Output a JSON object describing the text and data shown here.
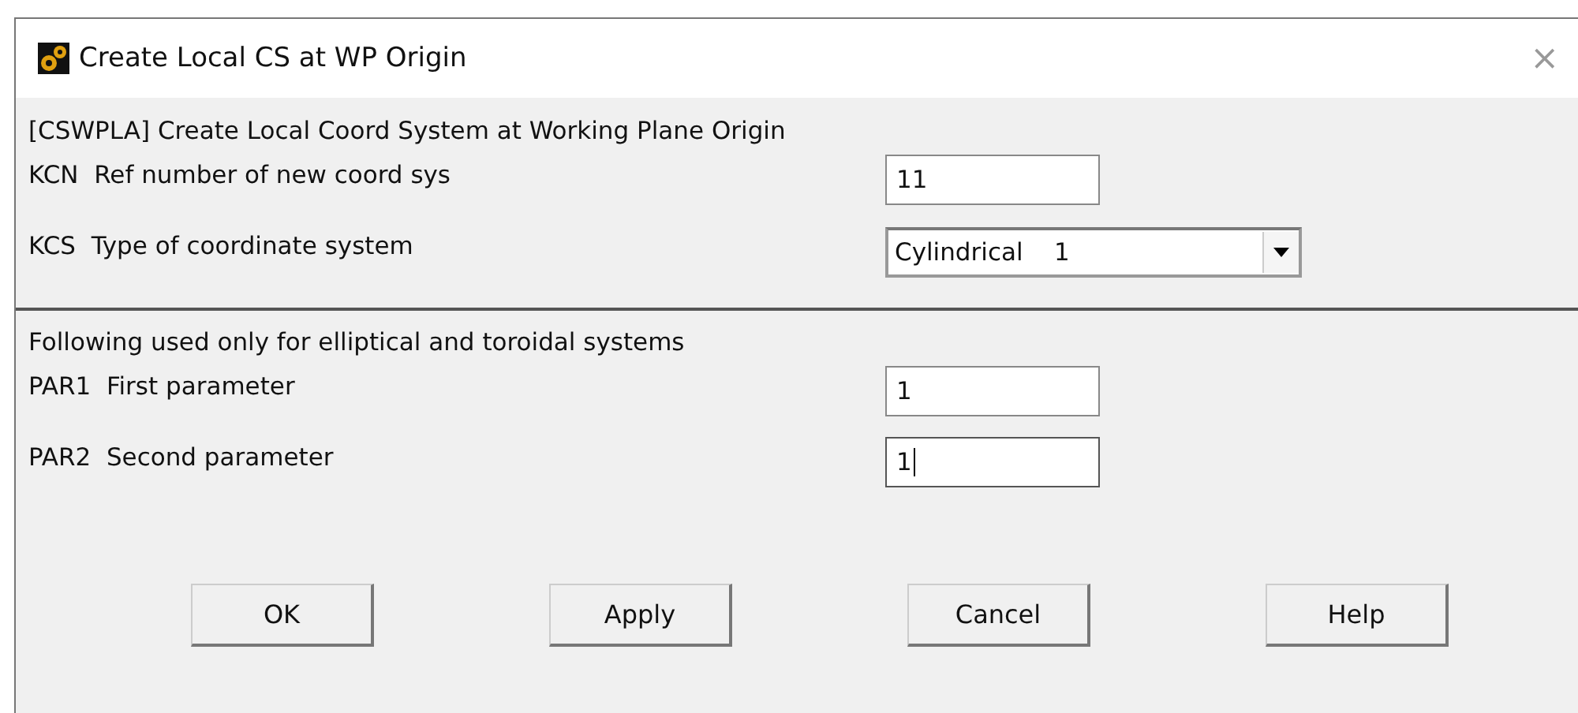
{
  "window": {
    "title": "Create Local CS at WP Origin",
    "close": "×"
  },
  "heading": "[CSWPLA]  Create Local Coord System at Working Plane Origin",
  "section1": [
    {
      "code": "KCN",
      "label": "Ref number of new coord sys",
      "kind": "text",
      "value": "11",
      "focused": false
    },
    {
      "code": "KCS",
      "label": "Type of coordinate system",
      "kind": "dropdown",
      "value": "Cylindrical    1",
      "focused": false
    }
  ],
  "note": "Following used only for elliptical and toroidal systems",
  "section2": [
    {
      "code": "PAR1",
      "label": "First parameter",
      "kind": "text",
      "value": "1",
      "focused": false
    },
    {
      "code": "PAR2",
      "label": "Second parameter",
      "kind": "text",
      "value": "1",
      "focused": true
    }
  ],
  "buttons": [
    "OK",
    "Apply",
    "Cancel",
    "Help"
  ]
}
